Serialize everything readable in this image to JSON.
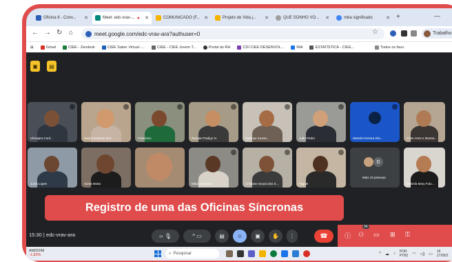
{
  "browser": {
    "tabs": [
      {
        "label": "Oficina 6 - Conv...",
        "color": "#2b5fb8",
        "active": false
      },
      {
        "label": "Meet: edc-vrav-...",
        "color": "#00897b",
        "active": true
      },
      {
        "label": "COMUNICADO (F...",
        "color": "#f4b400",
        "active": false
      },
      {
        "label": "Projeto de Vida j...",
        "color": "#f4b400",
        "active": false
      },
      {
        "label": "QUE SONHO VO...",
        "color": "#9e9e9e",
        "active": false
      },
      {
        "label": "mba significado",
        "color": "#4285f4",
        "active": false
      }
    ],
    "url": "meet.google.com/edc-vrav-ara?authuser=0",
    "profile_label": "Trabalho",
    "bookmarks": [
      "Gmail",
      "CIEE - Zendesk",
      "CIEE Saber Virtual -...",
      "CIEE - CIEE Jovem T...",
      "Portal do RH",
      "CDI CIEE DESENVOL...",
      "IRA",
      "ESTATÍSTICA - CIEE...",
      "Todos os favo"
    ]
  },
  "meet": {
    "participants_row1": [
      "Ubirajara Cord...",
      "Naomi Esteves Alm...",
      "Francisco",
      "Renata Pradigo N.",
      "Katrinye Kusmu",
      "João Pedro",
      "Wanda Ferreira Alm...",
      "Criss Artes e Mosaic..."
    ],
    "participants_row2": [
      "Junia Lopes",
      "Sonia Motta",
      "",
      "Maria Eduarda",
      "Cristiane Souza dos S...",
      "Miguel",
      "Mais 19 pessoas",
      "Daniela Mary Fulo..."
    ],
    "more_avatar_letter": "D",
    "caption": "Registro de uma das Oficinas Síncronas",
    "time": "15:30",
    "separator": "|",
    "meeting_code": "edc-vrav-ara",
    "participant_count": "34"
  },
  "taskbar": {
    "weather_temp": "AMDDIM",
    "weather_change": "-1,83%",
    "search_placeholder": "Pesquisar",
    "lang": "POR",
    "lang2": "PTB2",
    "clock_time": "16",
    "clock_date": "17/05/2"
  }
}
